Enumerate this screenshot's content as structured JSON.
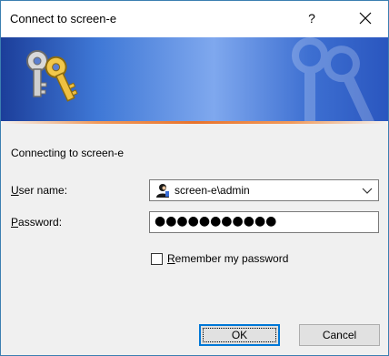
{
  "window": {
    "title": "Connect to screen-e",
    "help_glyph": "?",
    "close_icon": "close-icon"
  },
  "banner": {
    "icon": "keys-icon",
    "watermark_icon": "keys-watermark-icon"
  },
  "status": "Connecting to screen-e",
  "form": {
    "username_label_underlined": "U",
    "username_label_rest": "ser name:",
    "username_value": "screen-e\\admin",
    "username_icon": "user-icon",
    "password_label_underlined": "P",
    "password_label_rest": "assword:",
    "password_masked": "●●●●●●●●●●●",
    "remember_underlined": "R",
    "remember_rest": "emember my password",
    "remember_checked": false
  },
  "buttons": {
    "ok": "OK",
    "cancel": "Cancel"
  }
}
